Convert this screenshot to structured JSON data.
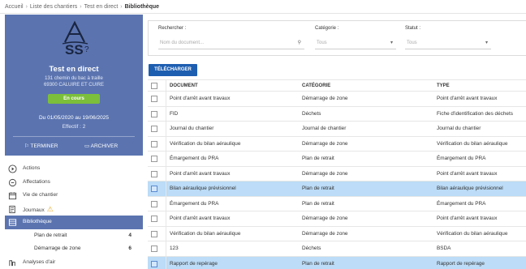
{
  "breadcrumb": [
    "Accueil",
    "Liste des chantiers",
    "Test en direct",
    "Bibliothèque"
  ],
  "sidebar": {
    "logo_icon": "asbestos-logo-icon",
    "project_title": "Test en direct",
    "address_line1": "131 chemin du bac à traille",
    "address_line2": "69300 CALUIRE ET CUIRE",
    "status": "En cours",
    "dates": "Du 01/05/2020 au 19/06/2025",
    "effectif": "Effectif : 2",
    "terminate_label": "TERMINER",
    "archive_label": "ARCHIVER",
    "menu": [
      {
        "label": "Actions",
        "icon": "play-circle-icon"
      },
      {
        "label": "Affectations",
        "icon": "assignment-icon"
      },
      {
        "label": "Vie de chantier",
        "icon": "calendar-icon"
      },
      {
        "label": "Journaux",
        "icon": "journal-icon"
      },
      {
        "label": "Bibliothèque",
        "icon": "library-icon"
      }
    ],
    "submenu": [
      {
        "label": "Plan de retrait",
        "count": "4"
      },
      {
        "label": "Démarrage de zone",
        "count": "6"
      }
    ],
    "last_item": {
      "label": "Analyses d'air",
      "icon": "air-analysis-icon"
    }
  },
  "filters": {
    "search_label": "Rechercher :",
    "search_placeholder": "Nom du document...",
    "category_label": "Catégorie :",
    "category_value": "Tous",
    "status_label": "Statut :",
    "status_value": "Tous"
  },
  "download_label": "TÉLÉCHARGER",
  "table": {
    "headers": [
      "DOCUMENT",
      "CATÉGORIE",
      "TYPE"
    ],
    "rows": [
      {
        "document": "Point d'arrêt avant travaux",
        "category": "Démarrage de zone",
        "type": "Point d'arrêt avant travaux",
        "selected": false
      },
      {
        "document": "FID",
        "category": "Déchets",
        "type": "Fiche d'identification des déchets",
        "selected": false
      },
      {
        "document": "Journal du chantier",
        "category": "Journal de chantier",
        "type": "Journal du chantier",
        "selected": false
      },
      {
        "document": "Vérification du bilan aéraulique",
        "category": "Démarrage de zone",
        "type": "Vérification du bilan aéraulique",
        "selected": false
      },
      {
        "document": "Émargement du PRA",
        "category": "Plan de retrait",
        "type": "Émargement du PRA",
        "selected": false
      },
      {
        "document": "Point d'arrêt avant travaux",
        "category": "Démarrage de zone",
        "type": "Point d'arrêt avant travaux",
        "selected": false
      },
      {
        "document": "Bilan aéraulique prévisionnel",
        "category": "Plan de retrait",
        "type": "Bilan aéraulique prévisionnel",
        "selected": true
      },
      {
        "document": "Émargement du PRA",
        "category": "Plan de retrait",
        "type": "Émargement du PRA",
        "selected": false
      },
      {
        "document": "Point d'arrêt avant travaux",
        "category": "Démarrage de zone",
        "type": "Point d'arrêt avant travaux",
        "selected": false
      },
      {
        "document": "Vérification du bilan aéraulique",
        "category": "Démarrage de zone",
        "type": "Vérification du bilan aéraulique",
        "selected": false
      },
      {
        "document": "123",
        "category": "Déchets",
        "type": "BSDA",
        "selected": false
      },
      {
        "document": "Rapport de repérage",
        "category": "Plan de retrait",
        "type": "Rapport de repérage",
        "selected": true
      }
    ]
  },
  "colors": {
    "accent": "#5b74b0",
    "status_green": "#7cbf3a",
    "primary_button": "#1e5eb0",
    "selected_row": "#bcdcf7",
    "warning": "#e8a92a"
  }
}
